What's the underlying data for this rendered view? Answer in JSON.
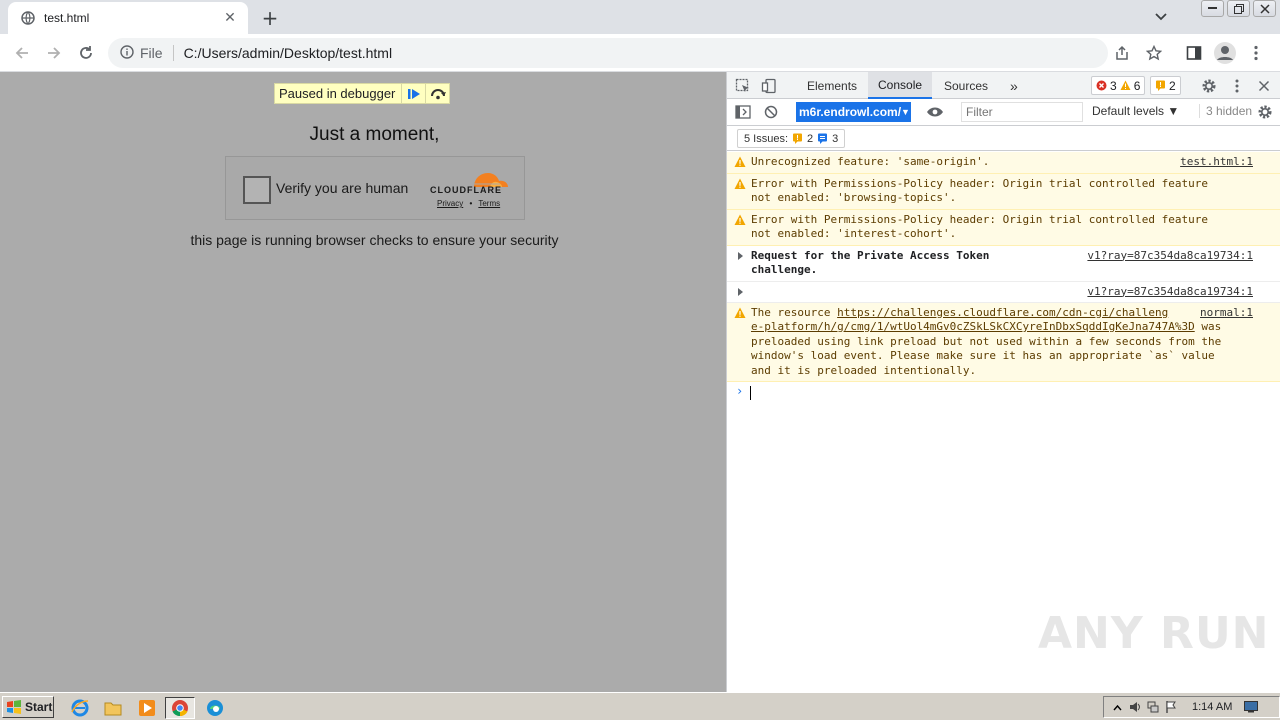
{
  "browser": {
    "tab_title": "test.html",
    "new_tab_label": "+",
    "file_label": "File",
    "url": "C:/Users/admin/Desktop/test.html"
  },
  "page": {
    "paused_label": "Paused in debugger",
    "heading": "Just a moment,",
    "verify_label": "Verify you are human",
    "brand": "CLOUDFLARE",
    "privacy_link": "Privacy",
    "link_separator": "•",
    "terms_link": "Terms",
    "subtext": "this page is running browser checks to ensure your security"
  },
  "devtools": {
    "tabs": [
      "Elements",
      "Console",
      "Sources"
    ],
    "more_tabs": "»",
    "error_count": "3",
    "warning_count": "6",
    "issue_badge_count": "2",
    "context": "m6r.endrowl.com/",
    "filter_placeholder": "Filter",
    "levels_label": "Default levels ▼",
    "hidden_label": "3 hidden",
    "issues_label": "5 Issues:",
    "issues_warn": "2",
    "issues_info": "3",
    "messages": [
      {
        "level": "warn",
        "text": "Unrecognized feature: 'same-origin'.",
        "source": "test.html:1"
      },
      {
        "level": "warn",
        "text": "Error with Permissions-Policy header: Origin trial controlled feature\nnot enabled: 'browsing-topics'.",
        "source": ""
      },
      {
        "level": "warn",
        "text": "Error with Permissions-Policy header: Origin trial controlled feature\nnot enabled: 'interest-cohort'.",
        "source": ""
      },
      {
        "level": "info",
        "text": "Request for the Private Access Token\nchallenge.",
        "source": "v1?ray=87c354da8ca19734:1"
      },
      {
        "level": "info",
        "text": "",
        "source": "v1?ray=87c354da8ca19734:1"
      },
      {
        "level": "warn",
        "text_prefix": "The resource ",
        "link": "https://challenges.cloudflare.com/cdn-cgi/challeng\ne-platform/h/g/cmg/1/wtUol4mGv0cZSkLSkCXCyreInDbxSqddIgKeJna747A%3D",
        "text_suffix": " was\npreloaded using link preload but not used within a few seconds from the\nwindow's load event. Please make sure it has an appropriate `as` value\nand it is preloaded intentionally.",
        "source": "normal:1"
      }
    ]
  },
  "watermark": "ANY RUN",
  "taskbar": {
    "start_label": "Start",
    "clock": "1:14 AM"
  },
  "colors": {
    "accent": "#1a73e8",
    "warning_bg": "#fffbe5",
    "page_overlay": "#ababab",
    "cloudflare_orange": "#f38020"
  }
}
